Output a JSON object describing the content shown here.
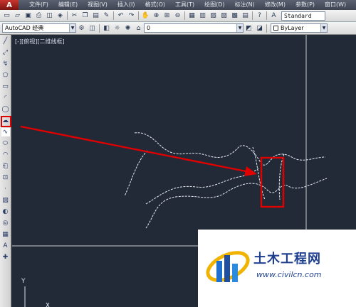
{
  "menubar": {
    "app_icon": "A",
    "items": [
      "文件(F)",
      "编辑(E)",
      "视图(V)",
      "插入(I)",
      "格式(O)",
      "工具(T)",
      "绘图(D)",
      "标注(N)",
      "修改(M)",
      "参数(P)",
      "窗口(W)"
    ]
  },
  "toolbar1": {
    "icons": [
      "new-icon",
      "open-icon",
      "save-icon",
      "print-icon",
      "preview-icon",
      "publish-icon",
      "cut-icon",
      "copy-icon",
      "paste-icon",
      "match-icon",
      "undo-icon",
      "redo-icon",
      "pan-icon",
      "zoom-icon",
      "zoom-window-icon",
      "zoom-previous-icon",
      "properties-icon",
      "design-center-icon",
      "tool-palettes-icon",
      "sheet-set-icon",
      "markup-icon",
      "calculator-icon",
      "help-icon",
      "text-style-icon"
    ],
    "text_style": "Standard"
  },
  "toolbar2": {
    "workspace": "AutoCAD 经典",
    "layer": "0",
    "color_style": "ByLayer"
  },
  "palette": {
    "tools": [
      "line-icon",
      "construction-line-icon",
      "polyline-icon",
      "polygon-icon",
      "rectangle-icon",
      "arc-icon",
      "circle-icon",
      "revision-cloud-icon",
      "spline-icon",
      "ellipse-icon",
      "ellipse-arc-icon",
      "insert-block-icon",
      "make-block-icon",
      "point-icon",
      "hatch-icon",
      "gradient-icon",
      "region-icon",
      "table-icon",
      "multiline-text-icon",
      "add-selected-icon"
    ]
  },
  "canvas": {
    "viewport_label": "[-][俯视][二维线框]",
    "ucs_y_label": "Y",
    "annotation_color": "#e00000"
  },
  "watermark": {
    "title": "土木工程网",
    "url": "www.civilcn.com"
  }
}
